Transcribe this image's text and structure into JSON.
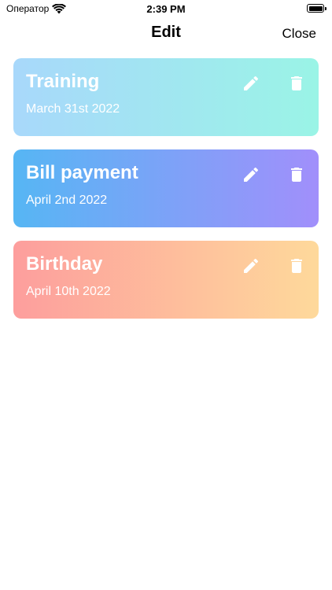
{
  "status_bar": {
    "carrier": "Оператор",
    "time": "2:39 PM"
  },
  "nav": {
    "title": "Edit",
    "close_label": "Close"
  },
  "events": [
    {
      "title": "Training",
      "date": "March 31st 2022",
      "gradient": [
        "#a8d8fb",
        "#9af4e6"
      ]
    },
    {
      "title": "Bill payment",
      "date": "April 2nd 2022",
      "gradient": [
        "#56b6f4",
        "#a18ffb"
      ]
    },
    {
      "title": "Birthday",
      "date": "April 10th 2022",
      "gradient": [
        "#fd9e9d",
        "#fed99b"
      ]
    }
  ],
  "icons": {
    "edit": "pencil-icon",
    "delete": "trash-icon"
  }
}
